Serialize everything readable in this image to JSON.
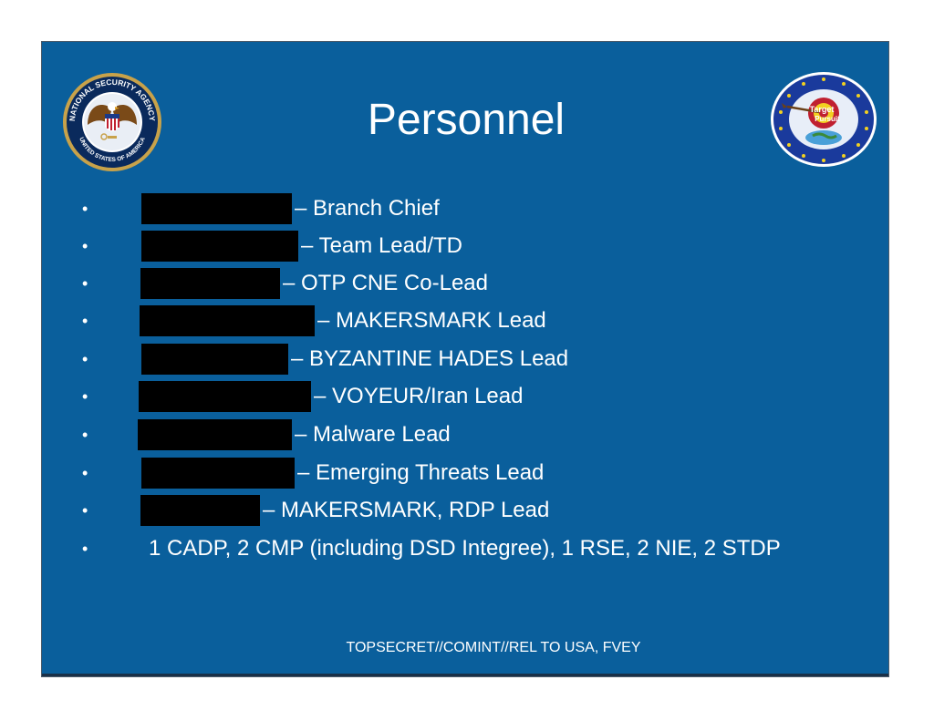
{
  "slide": {
    "title": "Personnel",
    "left_seal": {
      "icon": "nsa-seal-icon",
      "text_top": "NATIONAL SECURITY AGENCY",
      "text_bottom": "UNITED STATES OF AMERICA"
    },
    "right_seal": {
      "icon": "target-pursuit-logo-icon",
      "line1": "Target",
      "line2": "Pursuit"
    },
    "bullets": [
      {
        "role": "– Branch Chief",
        "redacted": true
      },
      {
        "role": "– Team Lead/TD",
        "redacted": true
      },
      {
        "role": "– OTP CNE Co-Lead",
        "redacted": true
      },
      {
        "role": "– MAKERSMARK Lead",
        "redacted": true
      },
      {
        "role": "– BYZANTINE HADES Lead",
        "redacted": true
      },
      {
        "role": "– VOYEUR/Iran Lead",
        "redacted": true
      },
      {
        "role": "– Malware Lead",
        "redacted": true
      },
      {
        "role": "– Emerging Threats Lead",
        "redacted": true
      },
      {
        "role": "– MAKERSMARK, RDP Lead",
        "redacted": true
      },
      {
        "role": "1 CADP, 2 CMP (including DSD Integree), 1 RSE, 2 NIE, 2 STDP",
        "redacted": false
      }
    ],
    "bullet_char": "•",
    "classification": "TOPSECRET//COMINT//REL TO USA, FVEY",
    "colors": {
      "background": "#0a5f9c",
      "text": "#ffffff",
      "redaction": "#000000"
    }
  }
}
